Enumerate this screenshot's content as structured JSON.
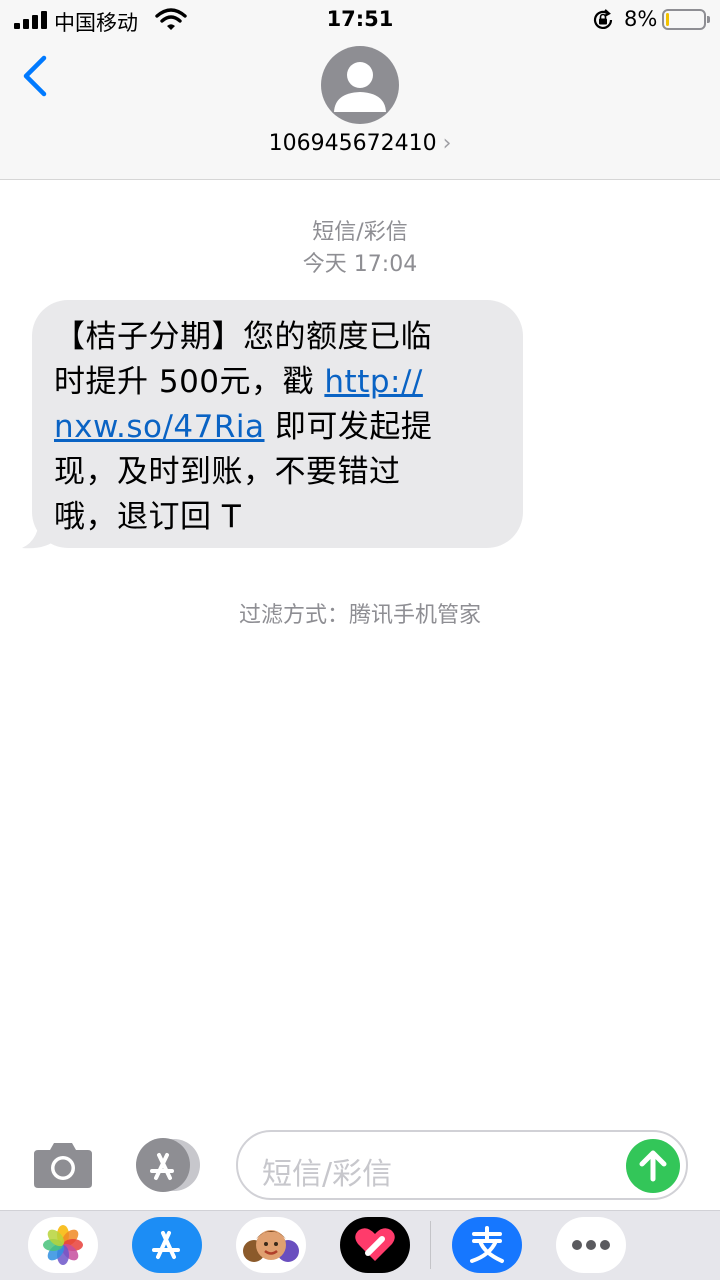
{
  "status_bar": {
    "carrier": "中国移动",
    "time": "17:51",
    "battery_percent": "8%",
    "battery_level": 0.08,
    "icons": [
      "signal-icon",
      "wifi-icon",
      "rotation-lock-icon",
      "battery-icon"
    ]
  },
  "header": {
    "contact": "106945672410",
    "chevron": "›"
  },
  "conversation": {
    "channel": "短信/彩信",
    "timestamp": "今天 17:04",
    "message": {
      "text_before": "【桔子分期】您的额度已临时提升 500元，戳 ",
      "link": "http://nxw.so/47Ria",
      "link_line1": "http://",
      "link_line2": "nxw.so/47Ria",
      "text_after": " 即可发起提现，及时到账，不要错过哦，退订回 T",
      "line2_prefix": "时提升 500元，戳 ",
      "line1": "【桔子分期】您的额度已临",
      "line3_suffix": " 即可发起提",
      "line4": "现，及时到账，不要错过",
      "line5": "哦，退订回 T"
    },
    "filter_note": "过滤方式：腾讯手机管家"
  },
  "input_bar": {
    "placeholder": "短信/彩信"
  },
  "app_drawer": {
    "apps": [
      "photos-app-icon",
      "app-store-icon",
      "memoji-icon",
      "digital-touch-icon",
      "alipay-icon",
      "more-apps-icon"
    ]
  },
  "colors": {
    "link": "#0a63c4",
    "bubble": "#e9e9eb",
    "send": "#33c659",
    "accent": "#007aff",
    "alipay": "#1677ff"
  }
}
